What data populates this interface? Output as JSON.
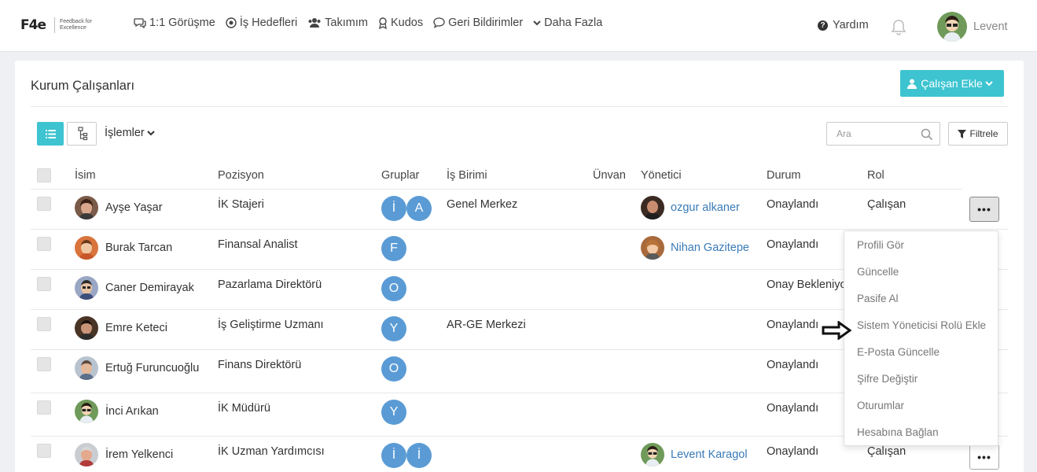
{
  "brand": {
    "logo_text": "F4e",
    "tagline": "Feedback for Excellence"
  },
  "nav": [
    {
      "label": "1:1 Görüşme",
      "icon": "chat-icon"
    },
    {
      "label": "İş Hedefleri",
      "icon": "target-icon"
    },
    {
      "label": "Takımım",
      "icon": "users-icon"
    },
    {
      "label": "Kudos",
      "icon": "award-icon"
    },
    {
      "label": "Geri Bildirimler",
      "icon": "comment-icon"
    },
    {
      "label": "Daha Fazla",
      "icon": "chevron-down-icon"
    }
  ],
  "header": {
    "help_label": "Yardım",
    "user_name": "Levent"
  },
  "page": {
    "title": "Kurum Çalışanları",
    "add_button": "Çalışan Ekle",
    "operations": "İşlemler",
    "search_placeholder": "Ara",
    "filter_label": "Filtrele"
  },
  "table": {
    "columns": {
      "name": "İsim",
      "position": "Pozisyon",
      "groups": "Gruplar",
      "unit": "İş Birimi",
      "title": "Ünvan",
      "manager": "Yönetici",
      "status": "Durum",
      "role": "Rol"
    },
    "rows": [
      {
        "name": "Ayşe Yaşar",
        "position": "İK Stajeri",
        "groups": [
          "İ",
          "A"
        ],
        "unit": "Genel Merkez",
        "manager": "ozgur alkaner",
        "status": "Onaylandı",
        "role": "Çalışan"
      },
      {
        "name": "Burak Tarcan",
        "position": "Finansal Analist",
        "groups": [
          "F"
        ],
        "unit": "",
        "manager": "Nihan Gazitepe",
        "status": "Onaylandı",
        "role": ""
      },
      {
        "name": "Caner Demirayak",
        "position": "Pazarlama Direktörü",
        "groups": [
          "O"
        ],
        "unit": "",
        "manager": "",
        "status": "Onay Bekleniyo",
        "role": ""
      },
      {
        "name": "Emre Keteci",
        "position": "İş Geliştirme Uzmanı",
        "groups": [
          "Y"
        ],
        "unit": "AR-GE Merkezi",
        "manager": "",
        "status": "Onaylandı",
        "role": ""
      },
      {
        "name": "Ertuğ Furuncuoğlu",
        "position": "Finans Direktörü",
        "groups": [
          "O"
        ],
        "unit": "",
        "manager": "",
        "status": "Onaylandı",
        "role": ""
      },
      {
        "name": "İnci Arıkan",
        "position": "İK Müdürü",
        "groups": [
          "Y"
        ],
        "unit": "",
        "manager": "",
        "status": "Onaylandı",
        "role": ""
      },
      {
        "name": "İrem Yelkenci",
        "position": "İK Uzman Yardımcısı",
        "groups": [
          "İ",
          "İ"
        ],
        "unit": "",
        "manager": "Levent Karagol",
        "status": "Onaylandı",
        "role": "Çalışan"
      }
    ]
  },
  "action_menu": [
    "Profili Gör",
    "Güncelle",
    "Pasife Al",
    "Sistem Yöneticisi Rolü Ekle",
    "E-Posta Güncelle",
    "Şifre Değiştir",
    "Oturumlar",
    "Hesabına Bağlan"
  ],
  "colors": {
    "accent": "#3dc4d0",
    "badge": "#5a9bd5",
    "link": "#3a7ab8"
  }
}
